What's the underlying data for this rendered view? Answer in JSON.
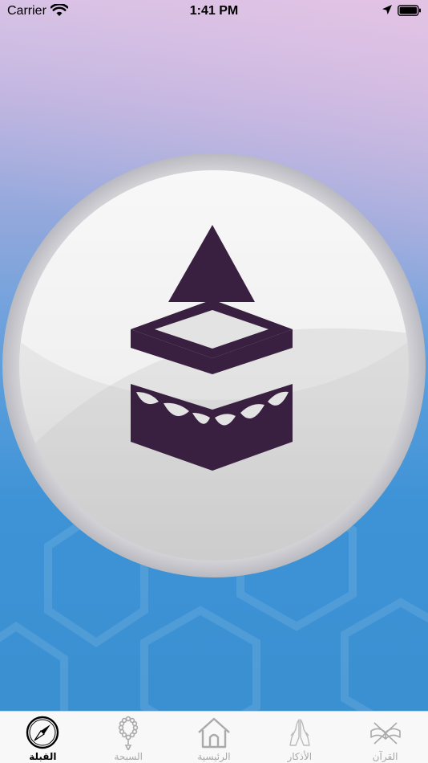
{
  "status_bar": {
    "carrier": "Carrier",
    "time": "1:41 PM"
  },
  "theme": {
    "kaaba_color": "#3a2040",
    "active_tab_color": "#000000",
    "inactive_tab_color": "#a8a8a8"
  },
  "qibla": {
    "direction_icon": "qibla-arrow-icon",
    "center_icon": "kaaba-icon"
  },
  "tabs": [
    {
      "label": "القبلة",
      "icon": "compass-icon",
      "active": true
    },
    {
      "label": "السبحة",
      "icon": "prayer-beads-icon",
      "active": false
    },
    {
      "label": "الرئيسية",
      "icon": "home-icon",
      "active": false
    },
    {
      "label": "الأذكار",
      "icon": "praying-hands-icon",
      "active": false
    },
    {
      "label": "القرآن",
      "icon": "quran-icon",
      "active": false
    }
  ]
}
